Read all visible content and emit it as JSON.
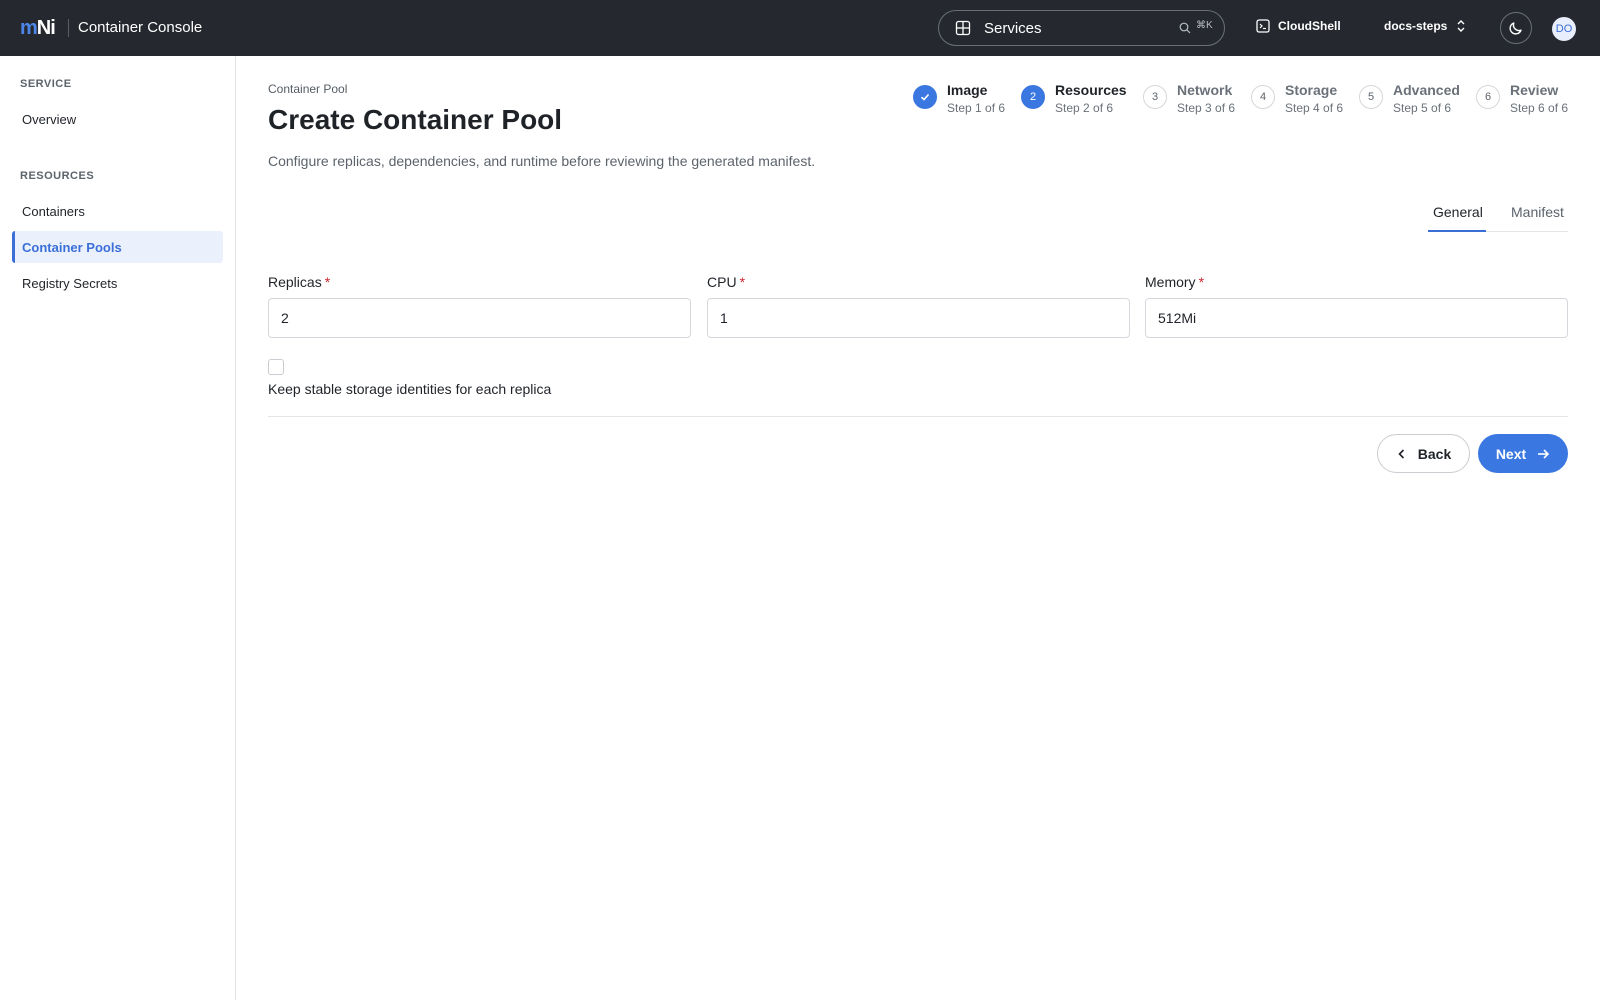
{
  "header": {
    "logo_m": "m",
    "logo_n": "Ni",
    "app_title": "Container Console",
    "search_text": "Services",
    "search_shortcut": "⌘K",
    "cloudshell_label": "CloudShell",
    "project_label": "docs-steps",
    "avatar_initials": "DO"
  },
  "sidebar": {
    "section_service": "SERVICE",
    "overview": "Overview",
    "section_resources": "RESOURCES",
    "containers": "Containers",
    "container_pools": "Container Pools",
    "registry_secrets": "Registry Secrets"
  },
  "page": {
    "breadcrumb": "Container Pool",
    "title": "Create Container Pool",
    "description": "Configure replicas, dependencies, and runtime before reviewing the generated manifest."
  },
  "steps": [
    {
      "number": "1",
      "name": "Image",
      "sub": "Step 1 of 6",
      "state": "done"
    },
    {
      "number": "2",
      "name": "Resources",
      "sub": "Step 2 of 6",
      "state": "current"
    },
    {
      "number": "3",
      "name": "Network",
      "sub": "Step 3 of 6",
      "state": "pending"
    },
    {
      "number": "4",
      "name": "Storage",
      "sub": "Step 4 of 6",
      "state": "pending"
    },
    {
      "number": "5",
      "name": "Advanced",
      "sub": "Step 5 of 6",
      "state": "pending"
    },
    {
      "number": "6",
      "name": "Review",
      "sub": "Step 6 of 6",
      "state": "pending"
    }
  ],
  "tabs": {
    "general": "General",
    "manifest": "Manifest"
  },
  "form": {
    "replicas_label": "Replicas",
    "replicas_value": "2",
    "cpu_label": "CPU",
    "cpu_value": "1",
    "memory_label": "Memory",
    "memory_value": "512Mi",
    "required_mark": "*",
    "stable_storage_label": "Keep stable storage identities for each replica",
    "stable_storage_checked": false
  },
  "actions": {
    "back": "Back",
    "next": "Next"
  },
  "colors": {
    "accent": "#3b77e0",
    "topbar": "#25292f",
    "required": "#d1242f"
  }
}
